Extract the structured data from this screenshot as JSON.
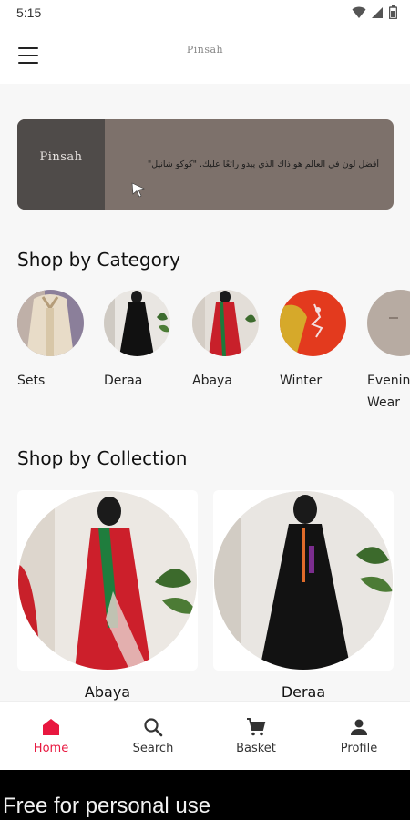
{
  "status_bar": {
    "time": "5:15",
    "icons": [
      "wifi-icon",
      "signal-icon",
      "battery-icon"
    ]
  },
  "app_bar": {
    "menu_icon": "menu-icon",
    "logo_text": "Pinsah"
  },
  "banner": {
    "logo_text": "Pinsah",
    "text": "أفضل لون في العالم هو ذاك الذي يبدو رائعًا عليك. \"كوكو شانيل\"",
    "cursor_icon": "cursor-icon"
  },
  "category_section": {
    "title": "Shop by Category",
    "items": [
      {
        "label": "Sets"
      },
      {
        "label": "Deraa"
      },
      {
        "label": "Abaya"
      },
      {
        "label": "Winter"
      },
      {
        "label": "Evening Wear"
      }
    ]
  },
  "collection_section": {
    "title": "Shop by Collection",
    "items": [
      {
        "label": "Abaya"
      },
      {
        "label": "Deraa"
      }
    ]
  },
  "bottom_nav": {
    "items": [
      {
        "label": "Home",
        "icon": "home-icon",
        "active": true
      },
      {
        "label": "Search",
        "icon": "search-icon",
        "active": false
      },
      {
        "label": "Basket",
        "icon": "cart-icon",
        "active": false
      },
      {
        "label": "Profile",
        "icon": "profile-icon",
        "active": false
      }
    ]
  },
  "colors": {
    "accent": "#e8173f",
    "banner_bg": "#7d716b",
    "banner_logo_bg": "#4f4b49"
  },
  "watermark": {
    "text": "Free for personal use"
  }
}
